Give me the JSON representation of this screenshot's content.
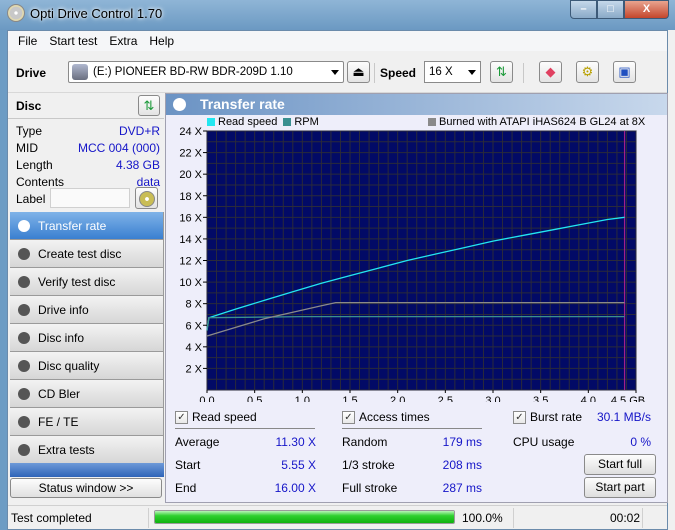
{
  "window": {
    "title": "Opti Drive Control 1.70",
    "controls": {
      "minimize": "–",
      "maximize": "□",
      "close": "X"
    }
  },
  "menu": [
    "File",
    "Start test",
    "Extra",
    "Help"
  ],
  "toolbar": {
    "drive_label": "Drive",
    "drive_value": "(E:)  PIONEER BD-RW   BDR-209D 1.10",
    "speed_label": "Speed",
    "speed_value": "16 X",
    "icons": [
      "eject-icon",
      "refresh-icon",
      "erase-icon",
      "settings-icon",
      "save-icon"
    ]
  },
  "disc": {
    "title": "Disc",
    "rows": [
      {
        "key": "Type",
        "value": "DVD+R"
      },
      {
        "key": "MID",
        "value": "MCC 004 (000)"
      },
      {
        "key": "Length",
        "value": "4.38 GB"
      },
      {
        "key": "Contents",
        "value": "data"
      }
    ],
    "label_key": "Label",
    "label_value": ""
  },
  "nav": [
    {
      "label": "Transfer rate",
      "active": true
    },
    {
      "label": "Create test disc"
    },
    {
      "label": "Verify test disc"
    },
    {
      "label": "Drive info"
    },
    {
      "label": "Disc info"
    },
    {
      "label": "Disc quality"
    },
    {
      "label": "CD Bler"
    },
    {
      "label": "FE / TE"
    },
    {
      "label": "Extra tests"
    }
  ],
  "status_window_button": "Status window >>",
  "panel": {
    "title": "Transfer rate",
    "legend_read": "Read speed",
    "legend_rpm": "RPM",
    "legend_burned": "Burned with ATAPI iHAS624   B GL24 at 8X",
    "colors": {
      "read": "#22e6f0",
      "rpm": "#3a9090",
      "burned": "#8a8a8a",
      "plot_bg": "#020a66",
      "grid": "#2a2a3a",
      "end_marker": "#a0208c"
    }
  },
  "chart_data": {
    "type": "line",
    "xlabel": "GB",
    "ylabel": "X",
    "xlim": [
      0,
      4.5
    ],
    "ylim": [
      0,
      24
    ],
    "x_ticks": [
      "0.0",
      "0.5",
      "1.0",
      "1.5",
      "2.0",
      "2.5",
      "3.0",
      "3.5",
      "4.0",
      "4.5 GB"
    ],
    "y_ticks": [
      "2 X",
      "4 X",
      "6 X",
      "8 X",
      "10 X",
      "12 X",
      "14 X",
      "16 X",
      "18 X",
      "20 X",
      "22 X",
      "24 X"
    ],
    "grid": true,
    "end_marker_x": 4.38,
    "series": [
      {
        "name": "Read speed",
        "x": [
          0,
          0.02,
          0.3,
          0.6,
          0.9,
          1.2,
          1.5,
          1.8,
          2.1,
          2.4,
          2.7,
          3.0,
          3.3,
          3.6,
          3.9,
          4.2,
          4.38
        ],
        "y": [
          5.55,
          6.7,
          7.5,
          8.3,
          9.1,
          9.9,
          10.6,
          11.3,
          12.0,
          12.6,
          13.2,
          13.8,
          14.3,
          14.8,
          15.3,
          15.8,
          16.0
        ]
      },
      {
        "name": "RPM",
        "x": [
          0,
          0.02,
          0.5,
          1.0,
          1.5,
          2.0,
          2.5,
          3.0,
          3.5,
          4.0,
          4.38
        ],
        "y": [
          5.5,
          6.7,
          6.75,
          6.8,
          6.8,
          6.8,
          6.8,
          6.8,
          6.8,
          6.8,
          6.8
        ]
      },
      {
        "name": "Burned with ATAPI iHAS624",
        "x": [
          0,
          0.3,
          0.6,
          0.9,
          1.2,
          1.35,
          1.5,
          2.0,
          2.5,
          3.0,
          3.5,
          4.0,
          4.38
        ],
        "y": [
          5.0,
          5.8,
          6.6,
          7.2,
          7.8,
          8.1,
          8.1,
          8.1,
          8.1,
          8.1,
          8.1,
          8.1,
          8.1
        ]
      }
    ]
  },
  "stats": {
    "read_speed": {
      "label": "Read speed",
      "checked": true,
      "average_label": "Average",
      "average": "11.30 X",
      "start_label": "Start",
      "start": "5.55 X",
      "end_label": "End",
      "end": "16.00 X"
    },
    "access_times": {
      "label": "Access times",
      "checked": true,
      "random_label": "Random",
      "random": "179 ms",
      "third_label": "1/3 stroke",
      "third": "208 ms",
      "full_label": "Full stroke",
      "full": "287 ms"
    },
    "burst": {
      "label": "Burst rate",
      "checked": true,
      "value": "30.1 MB/s",
      "cpu_label": "CPU usage",
      "cpu": "0 %"
    },
    "start_full": "Start full",
    "start_part": "Start part"
  },
  "statusbar": {
    "text": "Test completed",
    "progress": 100,
    "progress_text": "100.0%",
    "elapsed": "00:02"
  }
}
